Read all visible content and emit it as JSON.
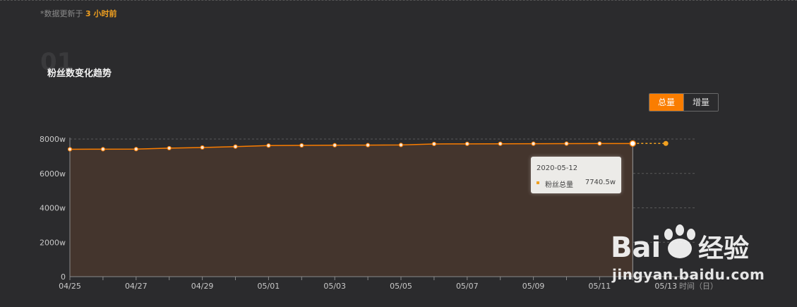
{
  "header": {
    "update_prefix": "*数据更新于",
    "update_value": "3 小时前"
  },
  "section": {
    "number": "01",
    "title": "粉丝数变化趋势"
  },
  "toggle": {
    "total_label": "总量",
    "increment_label": "增量",
    "active": "总量"
  },
  "tooltip": {
    "date": "2020-05-12",
    "series_label": "粉丝总量",
    "value": "7740.5w"
  },
  "axis_unit_label": "时间（日）",
  "watermark": {
    "text": "jingyan.baidu.com"
  },
  "colors": {
    "line": "#fa7d00",
    "area": "#44352d",
    "accent": "#f0a020",
    "background": "#2b2b2d"
  },
  "chart_data": {
    "type": "area",
    "x": [
      "04/25",
      "04/26",
      "04/27",
      "04/28",
      "04/29",
      "04/30",
      "05/01",
      "05/02",
      "05/03",
      "05/04",
      "05/05",
      "05/06",
      "05/07",
      "05/08",
      "05/09",
      "05/10",
      "05/11",
      "05/12",
      "05/13"
    ],
    "x_tick_labels": [
      "04/25",
      "04/27",
      "04/29",
      "05/01",
      "05/03",
      "05/05",
      "05/07",
      "05/09",
      "05/11",
      "05/13"
    ],
    "series": [
      {
        "values": [
          7405,
          7410,
          7415,
          7470,
          7510,
          7560,
          7620,
          7630,
          7640,
          7645,
          7655,
          7715,
          7720,
          7725,
          7728,
          7733,
          7737,
          7740.5,
          7745
        ]
      }
    ],
    "projected_from_index": 17,
    "y_ticks": [
      "0",
      "2000w",
      "4000w",
      "6000w",
      "8000w"
    ],
    "ylim": [
      0,
      8000
    ],
    "y_unit": "w",
    "grid": true,
    "highlighted_index": 17
  }
}
